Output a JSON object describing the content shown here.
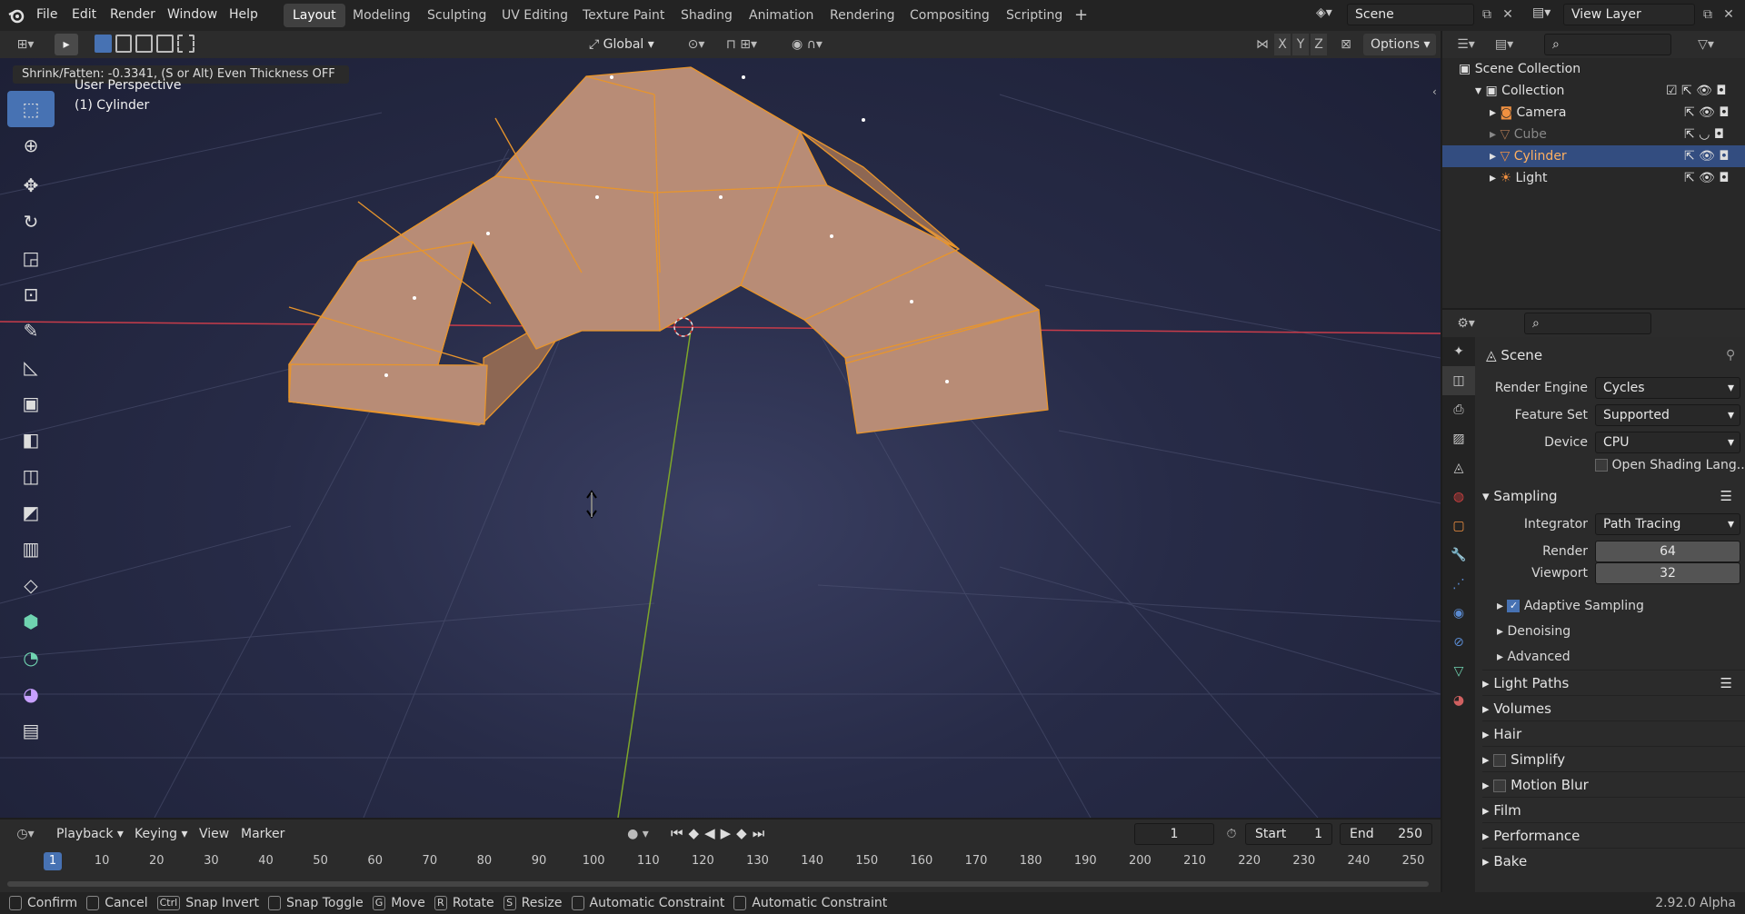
{
  "topbar": {
    "menus": [
      "File",
      "Edit",
      "Render",
      "Window",
      "Help"
    ],
    "workspaces": [
      "Layout",
      "Modeling",
      "Sculpting",
      "UV Editing",
      "Texture Paint",
      "Shading",
      "Animation",
      "Rendering",
      "Compositing",
      "Scripting"
    ],
    "add_tab": "+",
    "scene": "Scene",
    "view_layer": "View Layer"
  },
  "viewport_header": {
    "orientation": "Global",
    "options": "Options",
    "axes": [
      "X",
      "Y",
      "Z"
    ]
  },
  "viewport": {
    "operator_status": "Shrink/Fatten: -0.3341, (S or Alt) Even Thickness OFF",
    "perspective": "User Perspective",
    "object": "(1) Cylinder",
    "colors": {
      "mesh": "#b88c76",
      "edge": "#e8952c",
      "x_axis": "#c83c4a",
      "y_axis": "#7ea62a"
    }
  },
  "toolbar": {
    "tools": [
      "select-box",
      "cursor",
      "move",
      "rotate",
      "scale",
      "transform",
      "annotate",
      "measure",
      "add-cube",
      "extrude",
      "inset",
      "bevel",
      "loop-cut",
      "knife",
      "poly-build",
      "spin",
      "smooth",
      "edge-slide"
    ]
  },
  "timeline": {
    "menus": [
      "Playback",
      "Keying",
      "View",
      "Marker"
    ],
    "current_frame": "1",
    "start_label": "Start",
    "start": "1",
    "end_label": "End",
    "end": "250",
    "ruler": [
      "1",
      "10",
      "20",
      "30",
      "40",
      "50",
      "60",
      "70",
      "80",
      "90",
      "100",
      "110",
      "120",
      "130",
      "140",
      "150",
      "160",
      "170",
      "180",
      "190",
      "200",
      "210",
      "220",
      "230",
      "240",
      "250"
    ]
  },
  "statusbar": {
    "items": [
      "Confirm",
      "Cancel",
      "Snap Invert",
      "Snap Toggle",
      "Move",
      "Rotate",
      "Resize",
      "Automatic Constraint",
      "Automatic Constraint"
    ],
    "keys": [
      "",
      "",
      "Ctrl",
      "",
      "G",
      "R",
      "S",
      "",
      ""
    ],
    "version": "2.92.0 Alpha"
  },
  "outliner": {
    "root": "Scene Collection",
    "collection": "Collection",
    "items": [
      {
        "name": "Camera",
        "selected": false
      },
      {
        "name": "Cube",
        "selected": false
      },
      {
        "name": "Cylinder",
        "selected": true
      },
      {
        "name": "Light",
        "selected": false
      }
    ]
  },
  "properties": {
    "context": "Scene",
    "render_engine_label": "Render Engine",
    "render_engine": "Cycles",
    "feature_set_label": "Feature Set",
    "feature_set": "Supported",
    "device_label": "Device",
    "device": "CPU",
    "osl": "Open Shading Lang...",
    "sampling": "Sampling",
    "integrator_label": "Integrator",
    "integrator": "Path Tracing",
    "render_label": "Render",
    "render_samples": "64",
    "viewport_label": "Viewport",
    "viewport_samples": "32",
    "adaptive": "Adaptive Sampling",
    "denoising": "Denoising",
    "advanced": "Advanced",
    "panels": [
      "Light Paths",
      "Volumes",
      "Hair",
      "Simplify",
      "Motion Blur",
      "Film",
      "Performance",
      "Bake"
    ]
  }
}
